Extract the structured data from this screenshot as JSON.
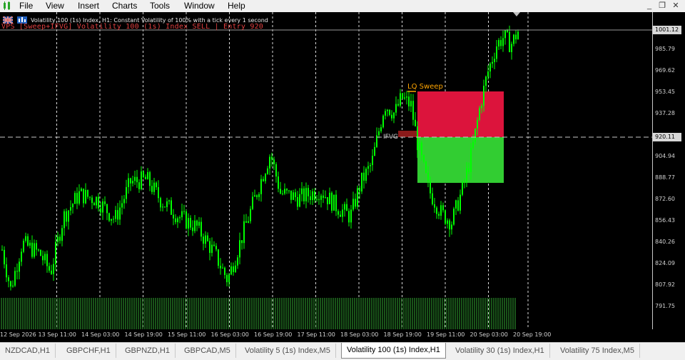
{
  "menu": {
    "items": [
      {
        "label": "File",
        "active": true
      },
      {
        "label": "View",
        "active": false
      },
      {
        "label": "Insert",
        "active": false
      },
      {
        "label": "Charts",
        "active": false
      },
      {
        "label": "Tools",
        "active": false
      },
      {
        "label": "Window",
        "active": false
      },
      {
        "label": "Help",
        "active": false
      }
    ]
  },
  "window_controls": {
    "minimize": "_",
    "restore": "❐",
    "close": "✕"
  },
  "chart": {
    "header": "Volatility 100 (1s) Index, H1: Constant Volatility of 100% with a tick every 1 second",
    "signal": "VPS [Sweep+IFVG] Volatility 100 (1s) Index  SELL  |  Entry 920",
    "lq_sweep_label": "LQ Sweep",
    "ifvg_label": "IFVG",
    "price_axis": {
      "labels": [
        "985.79",
        "969.62",
        "953.45",
        "937.28",
        "904.94",
        "888.77",
        "872.60",
        "856.43",
        "840.26",
        "824.09",
        "807.92",
        "791.75"
      ],
      "current_price": "1001.12",
      "entry_price": "920.11"
    },
    "time_axis": {
      "labels": [
        "12 Sep 2026",
        "13 Sep 11:00",
        "14 Sep 03:00",
        "14 Sep 19:00",
        "15 Sep 11:00",
        "16 Sep 03:00",
        "16 Sep 19:00",
        "17 Sep 11:00",
        "18 Sep 03:00",
        "18 Sep 19:00",
        "19 Sep 11:00",
        "20 Sep 03:00",
        "20 Sep 19:00"
      ]
    },
    "colors": {
      "background": "#000000",
      "candle": "#00ff00",
      "sell_zone": "#dc143c",
      "buy_zone": "#32cd32",
      "ifvg_zone": "#8b1a1a",
      "signal_text": "#e04040",
      "lq_label": "#ffa500",
      "volume": "#32a832"
    }
  },
  "tabs": {
    "items": [
      {
        "label": "NZDCAD,H1",
        "active": false
      },
      {
        "label": "GBPCHF,H1",
        "active": false
      },
      {
        "label": "GBPNZD,H1",
        "active": false
      },
      {
        "label": "GBPCAD,M5",
        "active": false
      },
      {
        "label": "Volatility 5 (1s) Index,M5",
        "active": false
      },
      {
        "label": "Volatility 100 (1s) Index,H1",
        "active": true
      },
      {
        "label": "Volatility 30 (1s) Index,H1",
        "active": false
      },
      {
        "label": "Volatility 75 Index,M5",
        "active": false
      }
    ]
  }
}
